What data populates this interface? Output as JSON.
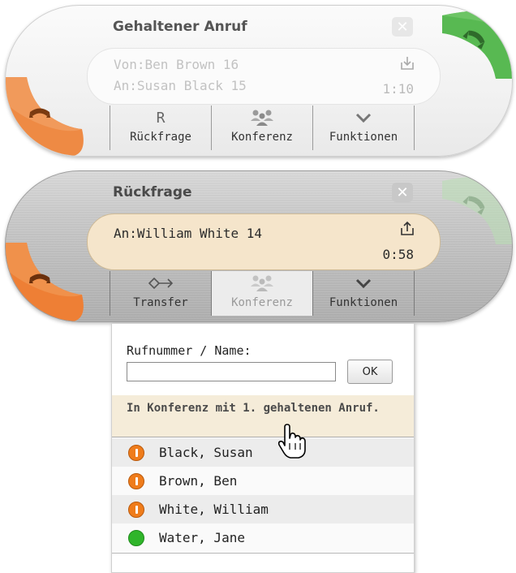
{
  "held_call": {
    "title": "Gehaltener Anruf",
    "from": "Von:Ben Brown 16",
    "to": "An:Susan Black 15",
    "duration": "1:10",
    "buttons": [
      {
        "icon": "letter-r-icon",
        "glyph": "R",
        "label": "Rückfrage"
      },
      {
        "icon": "conference-icon",
        "label": "Konferenz"
      },
      {
        "icon": "chevron-down-icon",
        "label": "Funktionen"
      }
    ]
  },
  "consult_call": {
    "title": "Rückfrage",
    "to": "An:William White 14",
    "duration": "0:58",
    "buttons": [
      {
        "icon": "transfer-icon",
        "label": "Transfer"
      },
      {
        "icon": "conference-icon",
        "label": "Konferenz",
        "disabled": true
      },
      {
        "icon": "chevron-down-icon",
        "label": "Funktionen"
      }
    ]
  },
  "conference_dropdown": {
    "label": "Rufnummer / Name:",
    "input_value": "",
    "ok_label": "OK",
    "info": "In Konferenz mit 1. gehaltenen Anruf.",
    "contacts": [
      {
        "name": "Black, Susan",
        "status": "busy"
      },
      {
        "name": "Brown, Ben",
        "status": "busy"
      },
      {
        "name": "White, William",
        "status": "busy"
      },
      {
        "name": "Water, Jane",
        "status": "available"
      }
    ]
  },
  "colors": {
    "busy": "#ef7c1b",
    "available": "#2fb52a",
    "hangup": "#ee8a44",
    "answer": "#55b84e",
    "consult_display": "#f5e5cb"
  }
}
